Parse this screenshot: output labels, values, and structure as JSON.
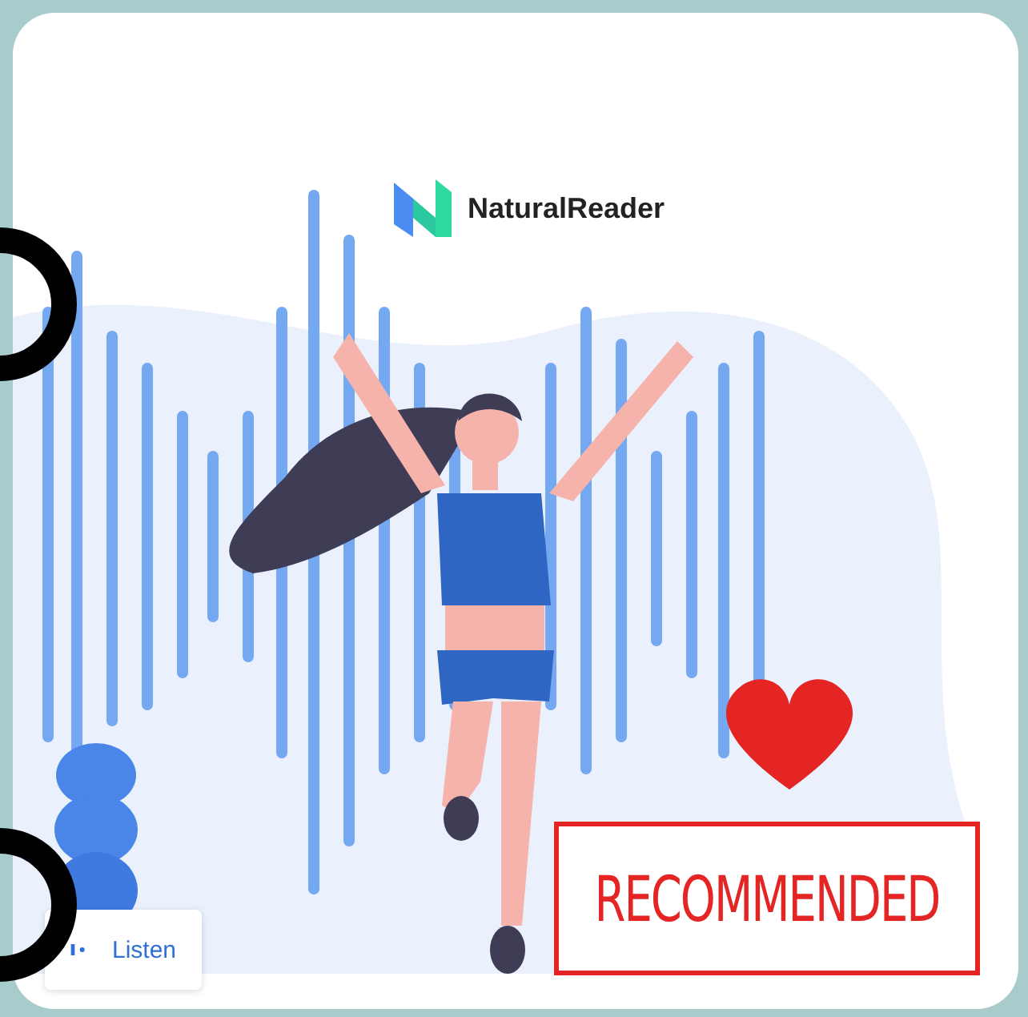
{
  "brand": {
    "name": "NaturalReader"
  },
  "badge": {
    "label": "RECOMMENDED"
  },
  "listen_button": {
    "label": "Listen"
  }
}
